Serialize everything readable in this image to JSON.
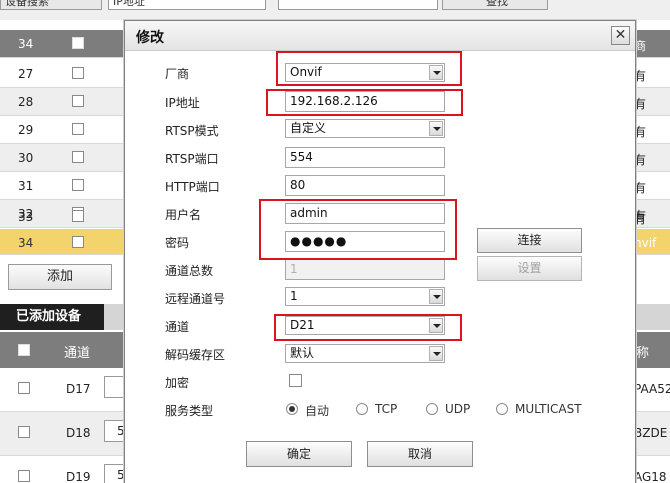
{
  "background": {
    "topbar": {
      "left_label": "设备搜索",
      "select_value": "IP地址",
      "search_button": "查找"
    },
    "head_row": {
      "num": "34",
      "right": "商"
    },
    "rows": [
      {
        "num": "27",
        "right": "有"
      },
      {
        "num": "28",
        "right": "有"
      },
      {
        "num": "29",
        "right": "有"
      },
      {
        "num": "30",
        "right": "有"
      },
      {
        "num": "31",
        "right": "有"
      },
      {
        "num": "32",
        "right": "有"
      },
      {
        "num": "33",
        "right": "有"
      },
      {
        "num": "34",
        "right": "nvif"
      }
    ],
    "add_button": "添加",
    "added_tab": "已添加设备",
    "added_header": {
      "channel": "通道",
      "right": "称"
    },
    "added_rows": [
      {
        "channel": "D17",
        "box": "",
        "right": "PAA52"
      },
      {
        "channel": "D18",
        "box": "5",
        "right": "BZDE"
      },
      {
        "channel": "D19",
        "box": "5",
        "right": "AG18"
      }
    ]
  },
  "dialog": {
    "title": "修改",
    "close_glyph": "✕",
    "labels": {
      "vendor": "厂商",
      "ip": "IP地址",
      "rtsp_mode": "RTSP模式",
      "rtsp_port": "RTSP端口",
      "http_port": "HTTP端口",
      "username": "用户名",
      "password": "密码",
      "channel_total": "通道总数",
      "remote_channel": "远程通道号",
      "channel": "通道",
      "decode_buffer": "解码缓存区",
      "encrypt": "加密",
      "service_type": "服务类型"
    },
    "values": {
      "vendor": "Onvif",
      "ip": "192.168.2.126",
      "rtsp_mode": "自定义",
      "rtsp_port": "554",
      "http_port": "80",
      "username": "admin",
      "password": "●●●●●",
      "channel_total": "1",
      "remote_channel": "1",
      "channel": "D21",
      "decode_buffer": "默认"
    },
    "encrypt_checked": false,
    "service_options": [
      {
        "label": "自动",
        "selected": true
      },
      {
        "label": "TCP",
        "selected": false
      },
      {
        "label": "UDP",
        "selected": false
      },
      {
        "label": "MULTICAST",
        "selected": false
      }
    ],
    "buttons": {
      "connect": "连接",
      "settings": "设置",
      "ok": "确定",
      "cancel": "取消"
    },
    "highlight_color": "#d8151e"
  }
}
